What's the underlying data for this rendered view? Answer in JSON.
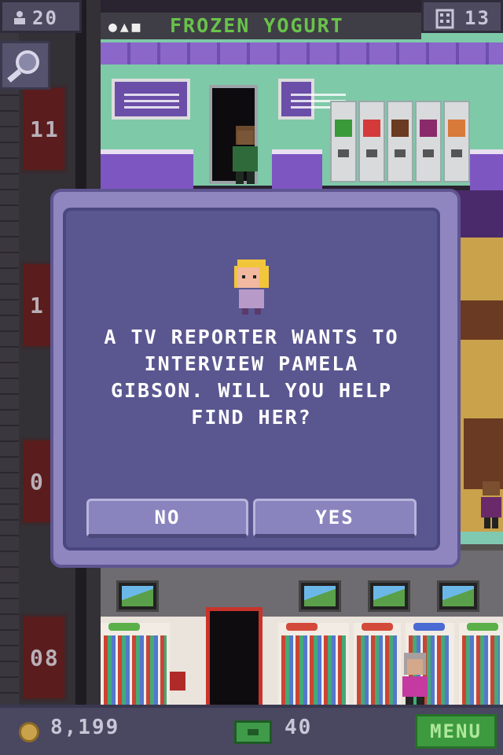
{
  "hud": {
    "population": "20",
    "floors": "13",
    "coins": "8,199",
    "tower_bux": "40",
    "menu_label": "MENU"
  },
  "room": {
    "title": "FROZEN YOGURT"
  },
  "shaft": {
    "floor_labels": [
      "11",
      "1",
      "0",
      "08"
    ]
  },
  "dialog": {
    "message": "A TV REPORTER WANTS TO\nINTERVIEW PAMELA\nGIBSON. WILL YOU HELP\nFIND HER?",
    "no_label": "NO",
    "yes_label": "YES"
  },
  "colors": {
    "dialog_bg": "#5a5790",
    "title_text": "#69c24a",
    "menu_button": "#3d9a3f"
  }
}
